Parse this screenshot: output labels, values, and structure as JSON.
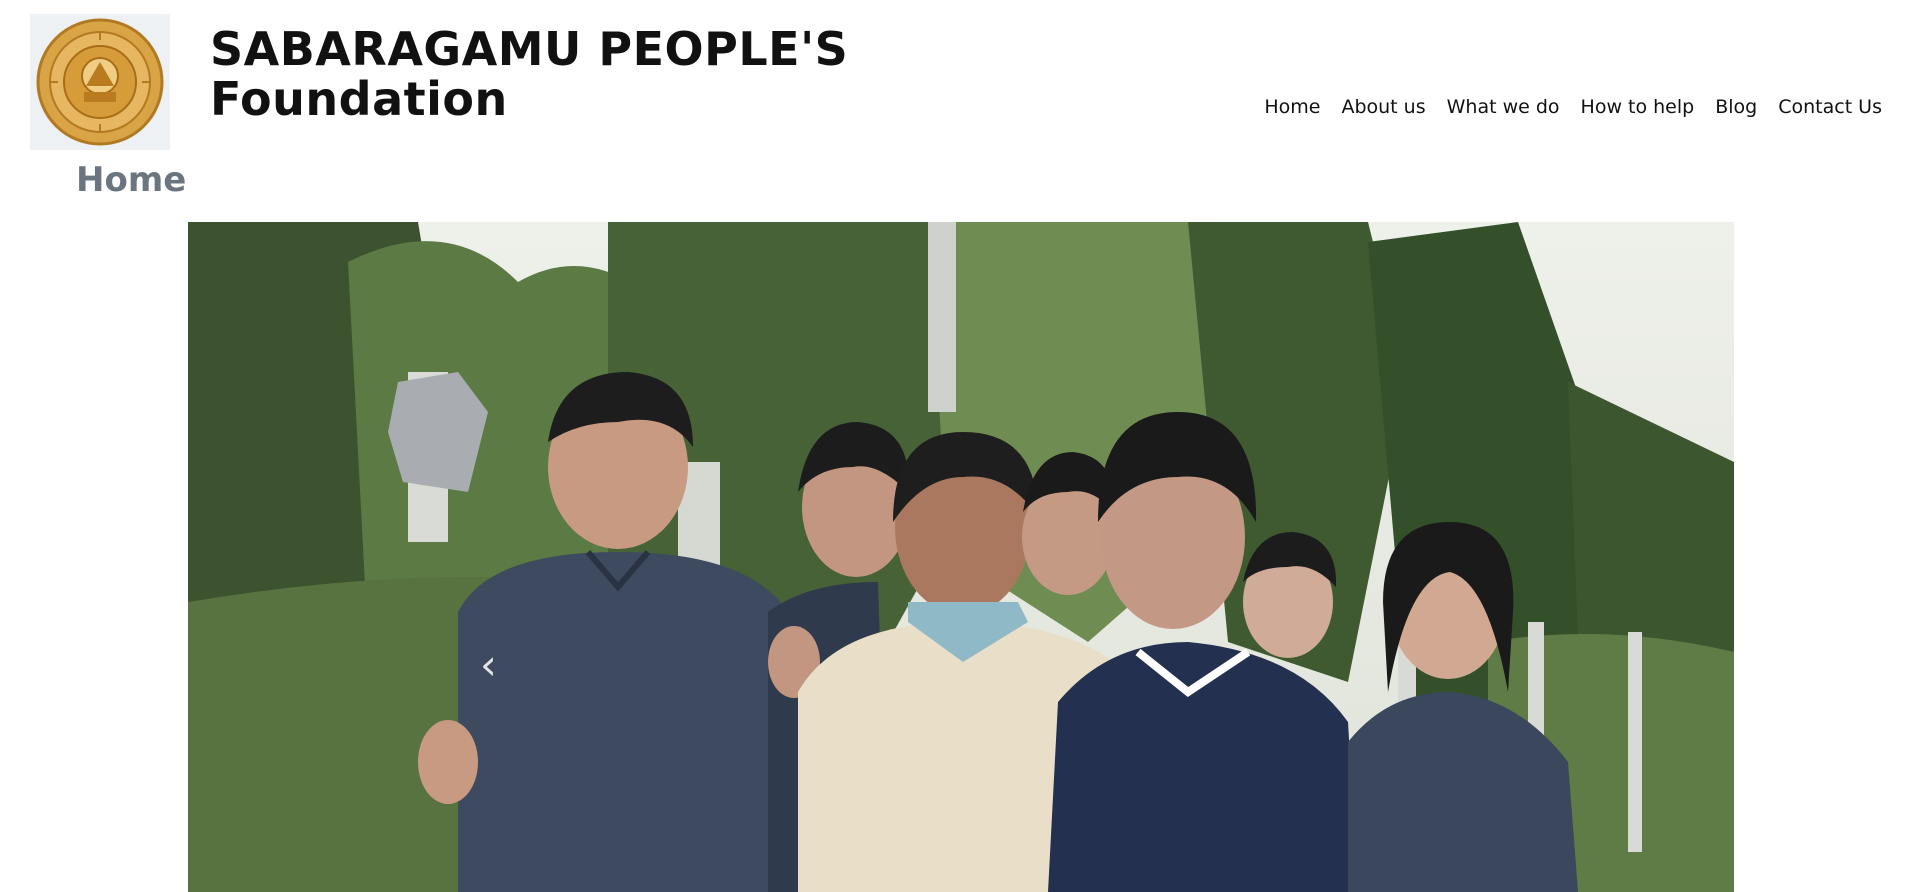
{
  "header": {
    "brand_line1": "SABARAGAMU PEOPLE'S",
    "brand_line2": "Foundation"
  },
  "nav": {
    "items": [
      {
        "label": "Home"
      },
      {
        "label": "About us"
      },
      {
        "label": "What we do"
      },
      {
        "label": "How to help"
      },
      {
        "label": "Blog"
      },
      {
        "label": "Contact Us"
      }
    ]
  },
  "page": {
    "title": "Home"
  },
  "carousel": {
    "prev_icon": "chevron-left-icon",
    "next_icon": "chevron-right-icon",
    "prev_glyph": "‹",
    "next_glyph": "›"
  },
  "colors": {
    "logo_gold": "#d4a13a",
    "logo_dark_gold": "#a86d17",
    "title_gray": "#6b7580"
  }
}
